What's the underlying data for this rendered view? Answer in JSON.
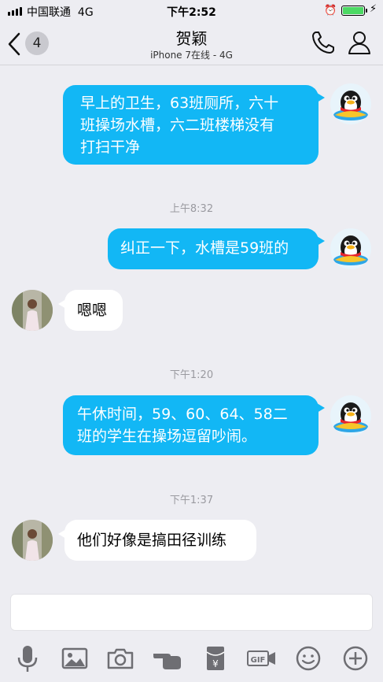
{
  "status_bar": {
    "carrier": "中国联通",
    "network": "4G",
    "time": "下午2:52"
  },
  "nav": {
    "back_badge": "4",
    "title": "贺颖",
    "subtitle": "iPhone 7在线 - 4G"
  },
  "messages": [
    {
      "side": "me",
      "text_lines": [
        "早上的卫生，63班厕所，六十",
        "班操场水槽，六二班楼梯没有",
        "打扫干净"
      ]
    },
    {
      "timestamp": "上午8:32"
    },
    {
      "side": "me",
      "text": "纠正一下，水槽是59班的"
    },
    {
      "side": "them",
      "text": "嗯嗯"
    },
    {
      "timestamp": "下午1:20"
    },
    {
      "side": "me",
      "text_lines": [
        "午休时间，59、60、64、58二",
        "班的学生在操场逗留吵闹。"
      ]
    },
    {
      "timestamp": "下午1:37"
    },
    {
      "side": "them",
      "text": "他们好像是搞田径训练"
    }
  ],
  "toolbar": {
    "icons": [
      "microphone-icon",
      "image-icon",
      "camera-icon",
      "poke-hand-icon",
      "red-packet-icon",
      "gif-icon",
      "emoji-icon",
      "plus-icon"
    ],
    "gif_label": "GIF",
    "yen_label": "¥"
  },
  "colors": {
    "background": "#ededf2",
    "sent_bubble": "#12b7f5",
    "received_bubble": "#ffffff",
    "battery": "#4cd964"
  }
}
